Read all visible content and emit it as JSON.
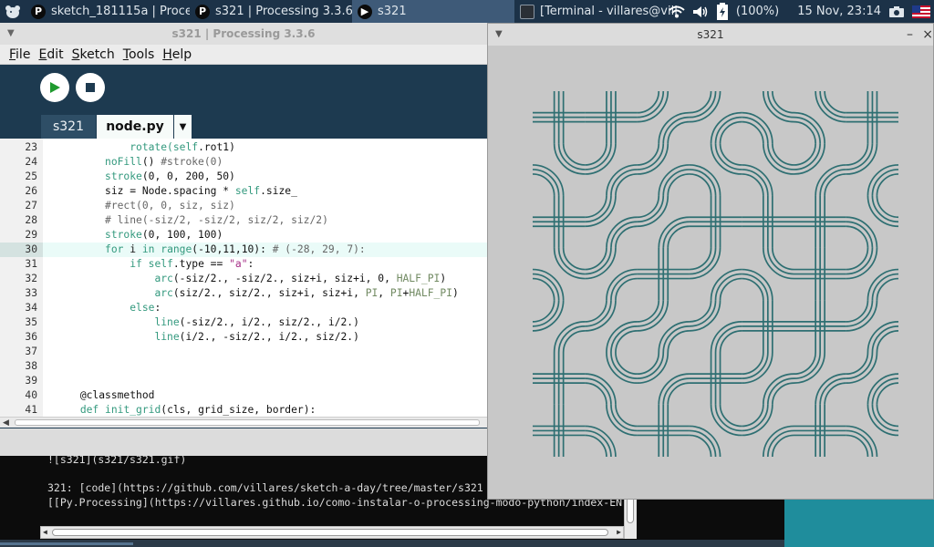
{
  "taskbar": {
    "tasks": [
      {
        "label": "sketch_181115a | Proce...",
        "icon": "processing-icon"
      },
      {
        "label": "s321 | Processing 3.3.6",
        "icon": "processing-icon"
      },
      {
        "label": "s321",
        "icon": "processing-icon"
      },
      {
        "label": "[Terminal - villares@villa...",
        "icon": "terminal-icon"
      }
    ],
    "battery": "(100%)",
    "clock": "15 Nov, 23:14"
  },
  "ide": {
    "title": "s321 | Processing 3.3.6",
    "menu": [
      {
        "first": "F",
        "rest": "ile"
      },
      {
        "first": "E",
        "rest": "dit"
      },
      {
        "first": "S",
        "rest": "ketch"
      },
      {
        "first": "T",
        "rest": "ools"
      },
      {
        "first": "H",
        "rest": "elp"
      }
    ],
    "tabs": [
      "s321",
      "node.py"
    ],
    "tab_menu_glyph": "▼"
  },
  "sketch": {
    "title": "s321",
    "min": "–",
    "close": "×",
    "stroke": "#2e6f72"
  },
  "console": {
    "lines": [
      "![s321](s321/s321.gif)",
      "",
      "321: [code](https://github.com/villares/sketch-a-day/tree/master/s321",
      "[[Py.Processing](https://villares.github.io/como-instalar-o-processing-modo-python/index-EN"
    ]
  },
  "code": [
    {
      "n": "23",
      "seg": [
        {
          "t": "            rotate(",
          "c": "kw"
        },
        {
          "t": "self",
          "c": "kw"
        },
        {
          "t": ".rot1)",
          "c": ""
        }
      ]
    },
    {
      "n": "24",
      "seg": [
        {
          "t": "        ",
          "c": ""
        },
        {
          "t": "noFill",
          "c": "kw"
        },
        {
          "t": "() ",
          "c": ""
        },
        {
          "t": "#stroke(0)",
          "c": "cm"
        }
      ]
    },
    {
      "n": "25",
      "seg": [
        {
          "t": "        ",
          "c": ""
        },
        {
          "t": "stroke",
          "c": "kw"
        },
        {
          "t": "(0, 0, 200, 50)",
          "c": ""
        }
      ]
    },
    {
      "n": "26",
      "seg": [
        {
          "t": "        siz = Node.spacing * ",
          "c": ""
        },
        {
          "t": "self",
          "c": "kw"
        },
        {
          "t": ".size_",
          "c": ""
        }
      ]
    },
    {
      "n": "27",
      "seg": [
        {
          "t": "        ",
          "c": ""
        },
        {
          "t": "#rect(0, 0, siz, siz)",
          "c": "cm"
        }
      ]
    },
    {
      "n": "28",
      "seg": [
        {
          "t": "        ",
          "c": ""
        },
        {
          "t": "# line(-siz/2, -siz/2, siz/2, siz/2)",
          "c": "cm"
        }
      ]
    },
    {
      "n": "29",
      "seg": [
        {
          "t": "        ",
          "c": ""
        },
        {
          "t": "stroke",
          "c": "kw"
        },
        {
          "t": "(0, 100, 100)",
          "c": ""
        }
      ]
    },
    {
      "n": "30",
      "hl": true,
      "seg": [
        {
          "t": "        ",
          "c": ""
        },
        {
          "t": "for",
          "c": "kw"
        },
        {
          "t": " i ",
          "c": ""
        },
        {
          "t": "in",
          "c": "kw"
        },
        {
          "t": " ",
          "c": ""
        },
        {
          "t": "range",
          "c": "kw"
        },
        {
          "t": "(-10,11,10): ",
          "c": ""
        },
        {
          "t": "# (-28, 29, 7):",
          "c": "cm"
        }
      ]
    },
    {
      "n": "31",
      "seg": [
        {
          "t": "            ",
          "c": ""
        },
        {
          "t": "if",
          "c": "kw"
        },
        {
          "t": " ",
          "c": ""
        },
        {
          "t": "self",
          "c": "kw"
        },
        {
          "t": ".type == ",
          "c": ""
        },
        {
          "t": "\"a\"",
          "c": "st"
        },
        {
          "t": ":",
          "c": ""
        }
      ]
    },
    {
      "n": "32",
      "seg": [
        {
          "t": "                ",
          "c": ""
        },
        {
          "t": "arc",
          "c": "kw"
        },
        {
          "t": "(-siz/2., -siz/2., siz+i, siz+i, 0, ",
          "c": ""
        },
        {
          "t": "HALF_PI",
          "c": "cn"
        },
        {
          "t": ")",
          "c": ""
        }
      ]
    },
    {
      "n": "33",
      "seg": [
        {
          "t": "                ",
          "c": ""
        },
        {
          "t": "arc",
          "c": "kw"
        },
        {
          "t": "(siz/2., siz/2., siz+i, siz+i, ",
          "c": ""
        },
        {
          "t": "PI",
          "c": "cn"
        },
        {
          "t": ", ",
          "c": ""
        },
        {
          "t": "PI",
          "c": "cn"
        },
        {
          "t": "+",
          "c": ""
        },
        {
          "t": "HALF_PI",
          "c": "cn"
        },
        {
          "t": ")",
          "c": ""
        }
      ]
    },
    {
      "n": "34",
      "seg": [
        {
          "t": "            ",
          "c": ""
        },
        {
          "t": "else",
          "c": "kw"
        },
        {
          "t": ":",
          "c": ""
        }
      ]
    },
    {
      "n": "35",
      "seg": [
        {
          "t": "                ",
          "c": ""
        },
        {
          "t": "line",
          "c": "kw"
        },
        {
          "t": "(-siz/2., i/2., siz/2., i/2.)",
          "c": ""
        }
      ]
    },
    {
      "n": "36",
      "seg": [
        {
          "t": "                ",
          "c": ""
        },
        {
          "t": "line",
          "c": "kw"
        },
        {
          "t": "(i/2., -siz/2., i/2., siz/2.)",
          "c": ""
        }
      ]
    },
    {
      "n": "37",
      "seg": []
    },
    {
      "n": "38",
      "seg": []
    },
    {
      "n": "39",
      "seg": []
    },
    {
      "n": "40",
      "seg": [
        {
          "t": "    @classmethod",
          "c": ""
        }
      ]
    },
    {
      "n": "41",
      "seg": [
        {
          "t": "    ",
          "c": ""
        },
        {
          "t": "def",
          "c": "kw"
        },
        {
          "t": " ",
          "c": ""
        },
        {
          "t": "init_grid",
          "c": "kw"
        },
        {
          "t": "(cls, grid_size, border):",
          "c": ""
        }
      ]
    }
  ]
}
